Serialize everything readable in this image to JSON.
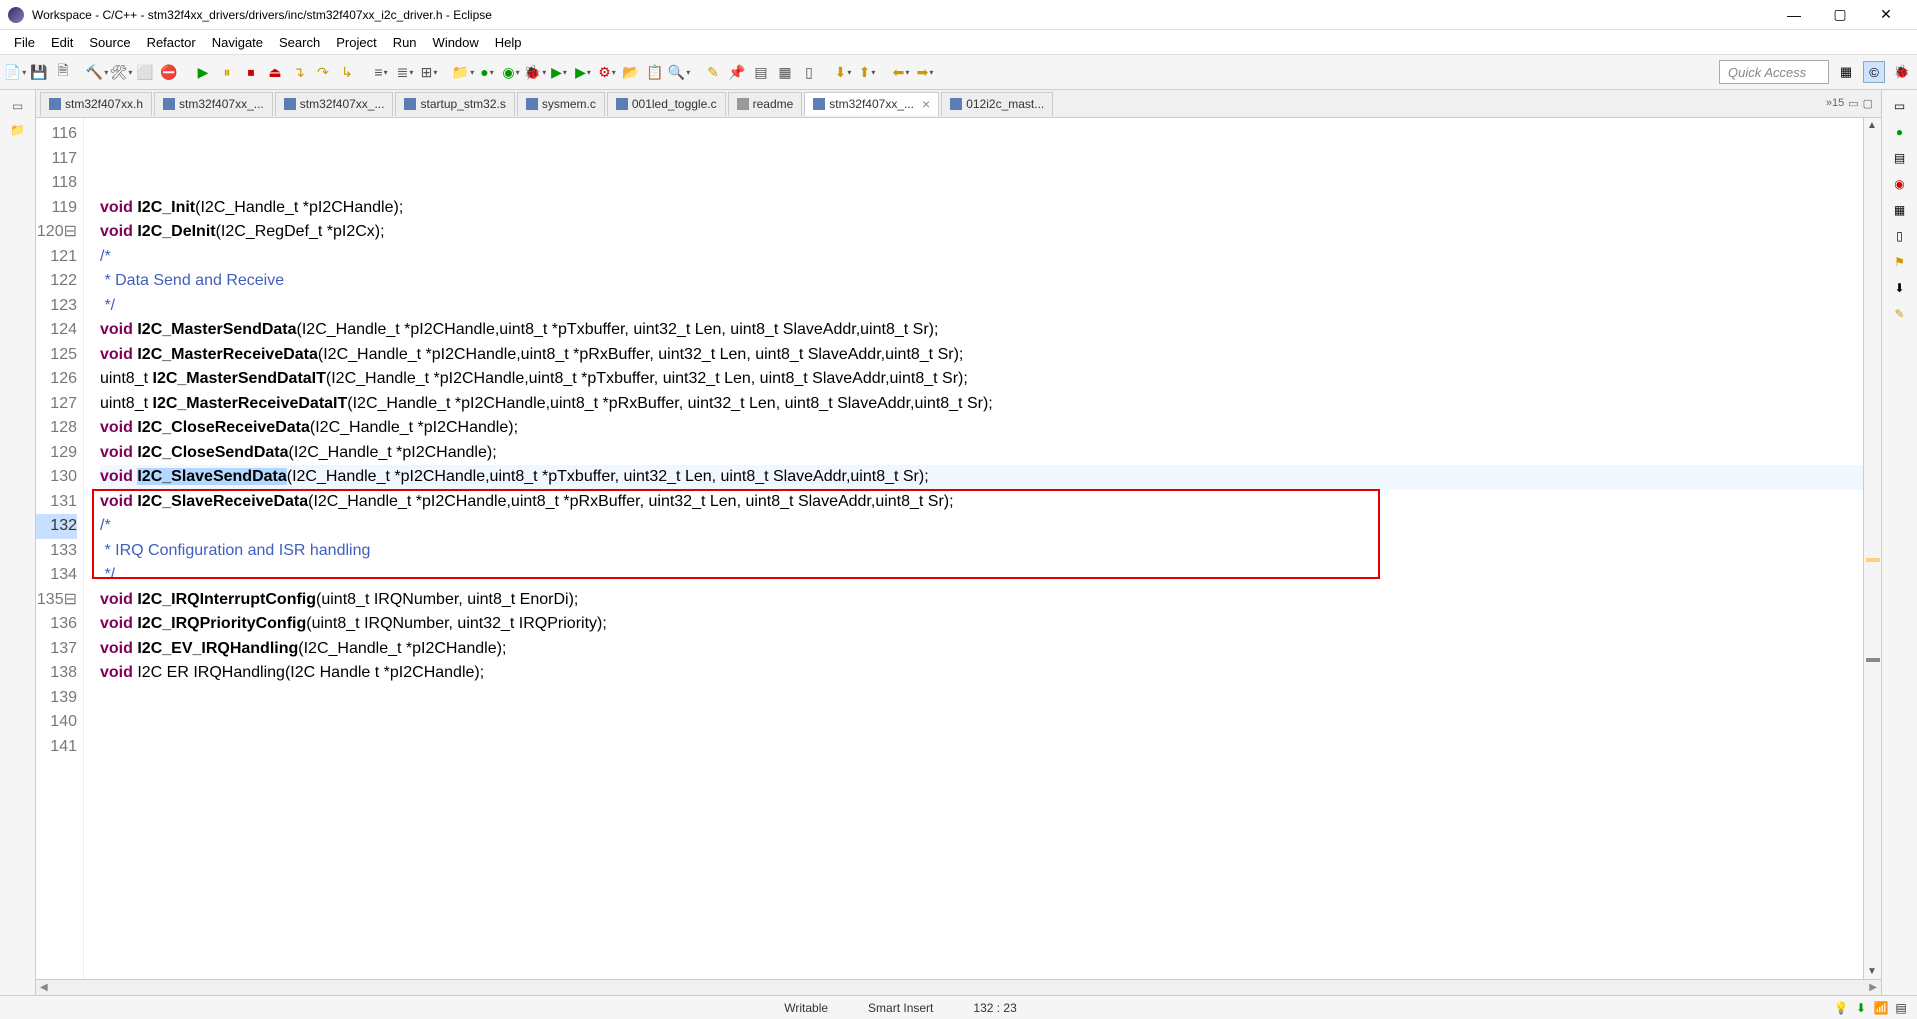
{
  "window": {
    "title": "Workspace - C/C++ - stm32f4xx_drivers/drivers/inc/stm32f407xx_i2c_driver.h - Eclipse"
  },
  "menu": {
    "items": [
      "File",
      "Edit",
      "Source",
      "Refactor",
      "Navigate",
      "Search",
      "Project",
      "Run",
      "Window",
      "Help"
    ]
  },
  "quick_access": "Quick Access",
  "tabs": [
    {
      "label": "stm32f407xx.h",
      "icon_color": "#5b7fb5"
    },
    {
      "label": "stm32f407xx_...",
      "icon_color": "#5b7fb5"
    },
    {
      "label": "stm32f407xx_...",
      "icon_color": "#5b7fb5"
    },
    {
      "label": "startup_stm32.s",
      "icon_color": "#5b7fb5"
    },
    {
      "label": "sysmem.c",
      "icon_color": "#5b7fb5"
    },
    {
      "label": "001led_toggle.c",
      "icon_color": "#5b7fb5"
    },
    {
      "label": "readme",
      "icon_color": "#999"
    },
    {
      "label": "stm32f407xx_...",
      "icon_color": "#5b7fb5",
      "active": true,
      "closable": true
    },
    {
      "label": "012i2c_mast...",
      "icon_color": "#5b7fb5"
    }
  ],
  "tabs_overflow": "»15",
  "code_lines": {
    "116": {
      "kw": "void",
      "fn": "I2C_Init",
      "rest": "(I2C_Handle_t *pI2CHandle);"
    },
    "117": {
      "kw": "void",
      "fn": "I2C_DeInit",
      "rest": "(I2C_RegDef_t *pI2Cx);"
    },
    "118": {
      "text": ""
    },
    "119": {
      "text": ""
    },
    "120": {
      "cm": "/*",
      "fold": true
    },
    "121": {
      "cm": " * Data Send and Receive"
    },
    "122": {
      "cm": " */"
    },
    "123": {
      "kw": "void",
      "fn": "I2C_MasterSendData",
      "rest": "(I2C_Handle_t *pI2CHandle,uint8_t *pTxbuffer, uint32_t Len, uint8_t SlaveAddr,uint8_t Sr);"
    },
    "124": {
      "kw": "void",
      "fn": "I2C_MasterReceiveData",
      "rest": "(I2C_Handle_t *pI2CHandle,uint8_t *pRxBuffer, uint32_t Len, uint8_t SlaveAddr,uint8_t Sr);"
    },
    "125": {
      "ty": "uint8_t",
      "fn": "I2C_MasterSendDataIT",
      "rest": "(I2C_Handle_t *pI2CHandle,uint8_t *pTxbuffer, uint32_t Len, uint8_t SlaveAddr,uint8_t Sr);"
    },
    "126": {
      "ty": "uint8_t",
      "fn": "I2C_MasterReceiveDataIT",
      "rest": "(I2C_Handle_t *pI2CHandle,uint8_t *pRxBuffer, uint32_t Len, uint8_t SlaveAddr,uint8_t Sr);"
    },
    "127": {
      "text": ""
    },
    "128": {
      "kw": "void",
      "fn": "I2C_CloseReceiveData",
      "rest": "(I2C_Handle_t *pI2CHandle);"
    },
    "129": {
      "kw": "void",
      "fn": "I2C_CloseSendData",
      "rest": "(I2C_Handle_t *pI2CHandle);"
    },
    "130": {
      "text": ""
    },
    "131": {
      "text": ""
    },
    "132": {
      "kw": "void",
      "sel_fn": "I2C_SlaveSendData",
      "rest": "(I2C_Handle_t *pI2CHandle,uint8_t *pTxbuffer, uint32_t Len, uint8_t SlaveAddr,uint8_t Sr);",
      "current": true
    },
    "133": {
      "kw": "void",
      "fn": "I2C_SlaveReceiveData",
      "rest": "(I2C_Handle_t *pI2CHandle,uint8_t *pRxBuffer, uint32_t Len, uint8_t SlaveAddr,uint8_t Sr);"
    },
    "134": {
      "text": ""
    },
    "135": {
      "cm": "/*",
      "fold": true
    },
    "136": {
      "cm": " * IRQ Configuration and ISR handling"
    },
    "137": {
      "cm": " */"
    },
    "138": {
      "kw": "void",
      "fn": "I2C_IRQInterruptConfig",
      "rest": "(uint8_t IRQNumber, uint8_t EnorDi);"
    },
    "139": {
      "kw": "void",
      "fn": "I2C_IRQPriorityConfig",
      "rest": "(uint8_t IRQNumber, uint32_t IRQPriority);"
    },
    "140": {
      "kw": "void",
      "fn": "I2C_EV_IRQHandling",
      "rest": "(I2C_Handle_t *pI2CHandle);"
    },
    "141": {
      "kw": "void",
      "fn_plain": "I2C ER IRQHandling",
      "rest": "(I2C Handle t *pI2CHandle);"
    }
  },
  "line_start": 116,
  "line_end": 141,
  "statusbar": {
    "writable": "Writable",
    "insert": "Smart Insert",
    "pos": "132 : 23"
  }
}
